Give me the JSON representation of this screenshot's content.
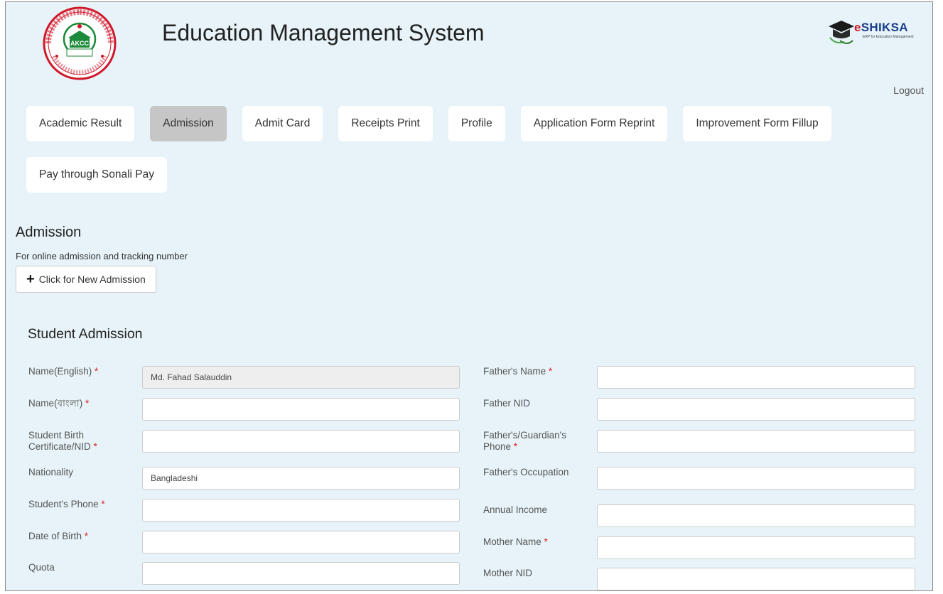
{
  "header": {
    "title": "Education Management System",
    "logo_initials": "AKCC",
    "brand_name_e": "e",
    "brand_name_rest": "SHIKSA",
    "brand_tagline": "ERP for Education Management",
    "logout_label": "Logout"
  },
  "nav": {
    "row1": [
      {
        "label": "Academic Result",
        "active": false
      },
      {
        "label": "Admission",
        "active": true
      },
      {
        "label": "Admit Card",
        "active": false
      },
      {
        "label": "Receipts Print",
        "active": false
      },
      {
        "label": "Profile",
        "active": false
      },
      {
        "label": "Application Form Reprint",
        "active": false
      },
      {
        "label": "Improvement Form Fillup",
        "active": false
      }
    ],
    "row2": [
      {
        "label": "Pay through Sonali Pay",
        "active": false
      }
    ]
  },
  "admission": {
    "title": "Admission",
    "subtitle": "For online admission and tracking number",
    "new_button_label": "Click for New Admission"
  },
  "form": {
    "title": "Student Admission",
    "left": [
      {
        "label": "Name(English)",
        "required": true,
        "value": "Md. Fahad Salauddin",
        "readonly": true
      },
      {
        "label": "Name(বাংলা)",
        "required": true,
        "value": "",
        "readonly": false
      },
      {
        "label": "Student Birth Certificate/NID",
        "required": true,
        "value": "",
        "readonly": false
      },
      {
        "label": "Nationality",
        "required": false,
        "value": "Bangladeshi",
        "readonly": false
      },
      {
        "label": "Student's Phone",
        "required": true,
        "value": "",
        "readonly": false
      },
      {
        "label": "Date of Birth",
        "required": true,
        "value": "",
        "readonly": false
      },
      {
        "label": "Quota",
        "required": false,
        "value": "",
        "readonly": false
      }
    ],
    "right": [
      {
        "label": "Father's Name",
        "required": true,
        "value": ""
      },
      {
        "label": "Father NID",
        "required": false,
        "value": ""
      },
      {
        "label": "Father's/Guardian's Phone",
        "required": true,
        "value": ""
      },
      {
        "label": "Father's Occupation",
        "required": false,
        "value": ""
      },
      {
        "label": "Annual Income",
        "required": false,
        "value": ""
      },
      {
        "label": "Mother Name",
        "required": true,
        "value": ""
      },
      {
        "label": "Mother NID",
        "required": false,
        "value": ""
      }
    ]
  },
  "colors": {
    "page_bg": "#e7f3f8",
    "active_tab": "#c6c6c6",
    "required_star": "#e02020",
    "brand_blue": "#1a3f8a",
    "brand_red": "#d0182b",
    "logo_green": "#1c8a3a",
    "logo_red": "#d0182b"
  }
}
